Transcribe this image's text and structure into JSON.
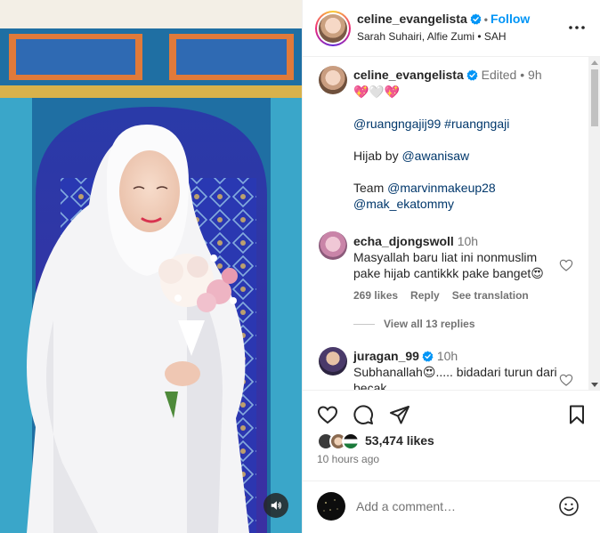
{
  "post": {
    "username": "celine_evangelista",
    "follow_label": "Follow",
    "separator": "•",
    "subtitle": "Sarah Suhairi, Alfie Zumi • SAH"
  },
  "caption": {
    "username": "celine_evangelista",
    "edited": "Edited",
    "dot": "•",
    "time": "9h",
    "emojis": "💖🤍💖",
    "tags_line": "@ruangngajij99 #ruangngaji",
    "hijab_prefix": "Hijab by ",
    "hijab_link": "@awanisaw",
    "team_prefix": "Team ",
    "team_link_1": "@marvinmakeup28",
    "team_link_2": "@mak_ekatommy"
  },
  "comments": [
    {
      "username": "echa_djongswoll",
      "time": "10h",
      "text": "Masyallah baru liat ini nonmuslim pake hijab cantikkk pake banget😍",
      "likes": "269 likes",
      "reply": "Reply",
      "see_translation": "See translation",
      "view_replies": "View all 13 replies"
    },
    {
      "username": "juragan_99",
      "time": "10h",
      "text": "Subhanallah😍..... bidadari turun dari becak"
    }
  ],
  "likes": {
    "count": "53,474 likes"
  },
  "time_ago": "10 hours ago",
  "add_comment": {
    "placeholder": "Add a comment…"
  },
  "icons": {
    "verified": "verified-badge-icon",
    "more": "more-options-icon",
    "like": "heart-icon",
    "comment": "comment-icon",
    "share": "share-icon",
    "save": "bookmark-icon",
    "emoji": "emoji-icon",
    "audio": "speaker-icon"
  },
  "colors": {
    "link": "#00376b",
    "follow": "#0095f6",
    "verified": "#0095f6",
    "muted": "#737373"
  }
}
